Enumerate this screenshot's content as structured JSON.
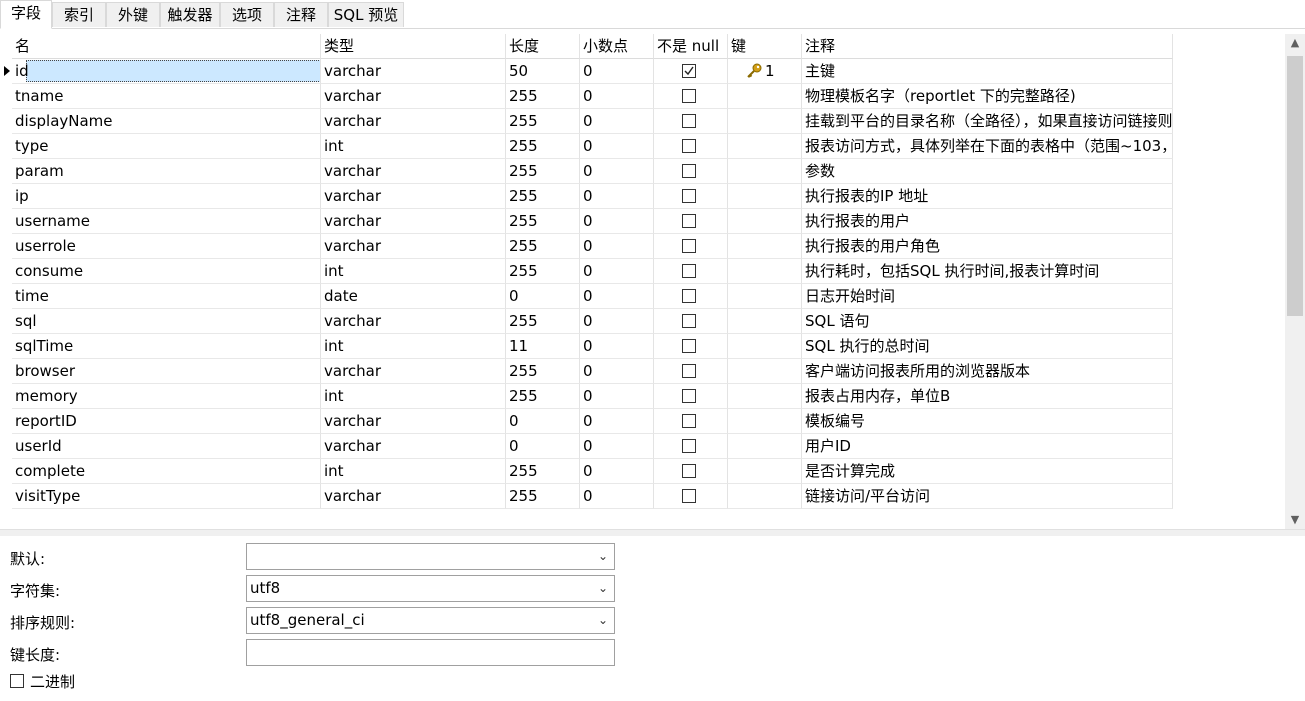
{
  "tabs": [
    "字段",
    "索引",
    "外键",
    "触发器",
    "选项",
    "注释",
    "SQL 预览"
  ],
  "columns": [
    "名",
    "类型",
    "长度",
    "小数点",
    "不是 null",
    "键",
    "注释"
  ],
  "rows": [
    {
      "name": "id",
      "type": "varchar",
      "length": "50",
      "decimals": "0",
      "not_null": true,
      "key": "1",
      "comment": "主键"
    },
    {
      "name": "tname",
      "type": "varchar",
      "length": "255",
      "decimals": "0",
      "not_null": false,
      "key": "",
      "comment": "物理模板名字（reportlet 下的完整路径)"
    },
    {
      "name": "displayName",
      "type": "varchar",
      "length": "255",
      "decimals": "0",
      "not_null": false,
      "key": "",
      "comment": "挂载到平台的目录名称（全路径），如果直接访问链接则"
    },
    {
      "name": "type",
      "type": "int",
      "length": "255",
      "decimals": "0",
      "not_null": false,
      "key": "",
      "comment": "报表访问方式，具体列举在下面的表格中（范围~103，"
    },
    {
      "name": "param",
      "type": "varchar",
      "length": "255",
      "decimals": "0",
      "not_null": false,
      "key": "",
      "comment": "参数"
    },
    {
      "name": "ip",
      "type": "varchar",
      "length": "255",
      "decimals": "0",
      "not_null": false,
      "key": "",
      "comment": "执行报表的IP 地址"
    },
    {
      "name": "username",
      "type": "varchar",
      "length": "255",
      "decimals": "0",
      "not_null": false,
      "key": "",
      "comment": "执行报表的用户"
    },
    {
      "name": "userrole",
      "type": "varchar",
      "length": "255",
      "decimals": "0",
      "not_null": false,
      "key": "",
      "comment": "执行报表的用户角色"
    },
    {
      "name": "consume",
      "type": "int",
      "length": "255",
      "decimals": "0",
      "not_null": false,
      "key": "",
      "comment": "执行耗时，包括SQL 执行时间,报表计算时间"
    },
    {
      "name": "time",
      "type": "date",
      "length": "0",
      "decimals": "0",
      "not_null": false,
      "key": "",
      "comment": "日志开始时间"
    },
    {
      "name": "sql",
      "type": "varchar",
      "length": "255",
      "decimals": "0",
      "not_null": false,
      "key": "",
      "comment": "SQL 语句"
    },
    {
      "name": "sqlTime",
      "type": "int",
      "length": "11",
      "decimals": "0",
      "not_null": false,
      "key": "",
      "comment": "SQL 执行的总时间"
    },
    {
      "name": "browser",
      "type": "varchar",
      "length": "255",
      "decimals": "0",
      "not_null": false,
      "key": "",
      "comment": "客户端访问报表所用的浏览器版本"
    },
    {
      "name": "memory",
      "type": "int",
      "length": "255",
      "decimals": "0",
      "not_null": false,
      "key": "",
      "comment": "报表占用内存，单位B"
    },
    {
      "name": "reportID",
      "type": "varchar",
      "length": "0",
      "decimals": "0",
      "not_null": false,
      "key": "",
      "comment": "模板编号"
    },
    {
      "name": "userId",
      "type": "varchar",
      "length": "0",
      "decimals": "0",
      "not_null": false,
      "key": "",
      "comment": "用户ID"
    },
    {
      "name": "complete",
      "type": "int",
      "length": "255",
      "decimals": "0",
      "not_null": false,
      "key": "",
      "comment": "是否计算完成"
    },
    {
      "name": "visitType",
      "type": "varchar",
      "length": "255",
      "decimals": "0",
      "not_null": false,
      "key": "",
      "comment": "链接访问/平台访问"
    }
  ],
  "properties": {
    "default_label": "默认:",
    "default_value": "",
    "charset_label": "字符集:",
    "charset_value": "utf8",
    "collation_label": "排序规则:",
    "collation_value": "utf8_general_ci",
    "key_length_label": "键长度:",
    "key_length_value": "",
    "binary_label": "二进制",
    "binary_checked": false
  },
  "icons": {
    "key": "key-icon",
    "row_marker": "current-row-marker-icon"
  },
  "colors": {
    "selection": "#cce8ff",
    "key_gold": "#d4a017"
  }
}
